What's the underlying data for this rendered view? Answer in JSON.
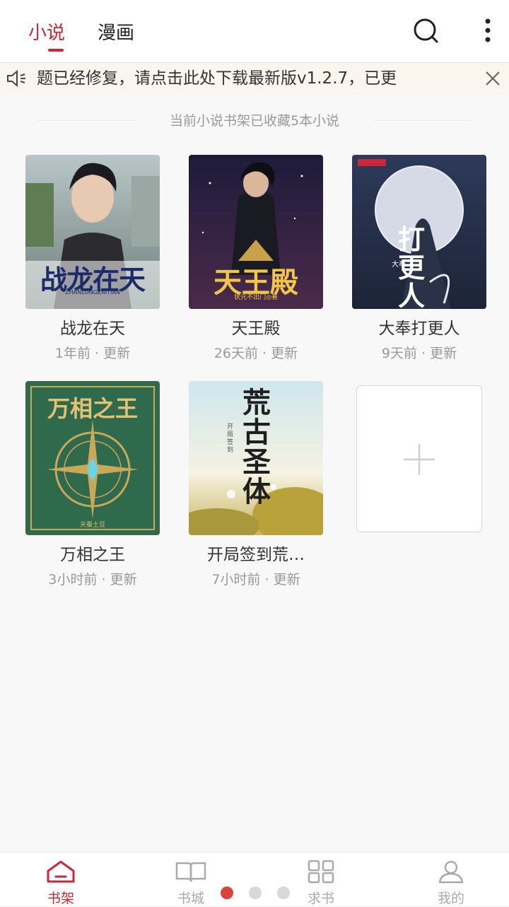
{
  "header": {
    "tabs": [
      {
        "label": "小说",
        "active": true
      },
      {
        "label": "漫画",
        "active": false
      }
    ],
    "search_icon": "search-icon",
    "more_icon": "more-vertical-icon"
  },
  "notice": {
    "text": "题已经修复，请点击此处下载最新版v1.2.7，已更",
    "speaker_icon": "speaker-icon",
    "close_icon": "close-icon"
  },
  "shelf": {
    "summary": "当前小说书架已收藏5本小说",
    "books": [
      {
        "title": "战龙在天",
        "updated": "1年前 · 更新",
        "cover_text": "战龙在天",
        "cover_subtext": "ZHANLONGZAITIAN"
      },
      {
        "title": "天王殿",
        "updated": "26天前 · 更新",
        "cover_text": "天王殿",
        "cover_subtext": "状元不出门◎著"
      },
      {
        "title": "大奉打更人",
        "updated": "9天前 · 更新",
        "cover_text": "打更人",
        "cover_subtext": "大奉"
      },
      {
        "title": "万相之王",
        "updated": "3小时前 · 更新",
        "cover_text": "万相之王",
        "cover_subtext": "天蚕土豆"
      },
      {
        "title": "开局签到荒…",
        "updated": "7小时前 · 更新",
        "cover_text": "荒古圣体",
        "cover_subtext": "开局签到"
      }
    ],
    "add_icon": "plus-icon"
  },
  "bottom_nav": {
    "items": [
      {
        "label": "书架",
        "icon": "home-icon",
        "active": true
      },
      {
        "label": "书城",
        "icon": "book-icon",
        "active": false
      },
      {
        "label": "求书",
        "icon": "grid-icon",
        "active": false
      },
      {
        "label": "我的",
        "icon": "user-icon",
        "active": false
      }
    ]
  },
  "colors": {
    "accent": "#c8283a",
    "background": "#f8f8f8",
    "muted": "#999999"
  }
}
